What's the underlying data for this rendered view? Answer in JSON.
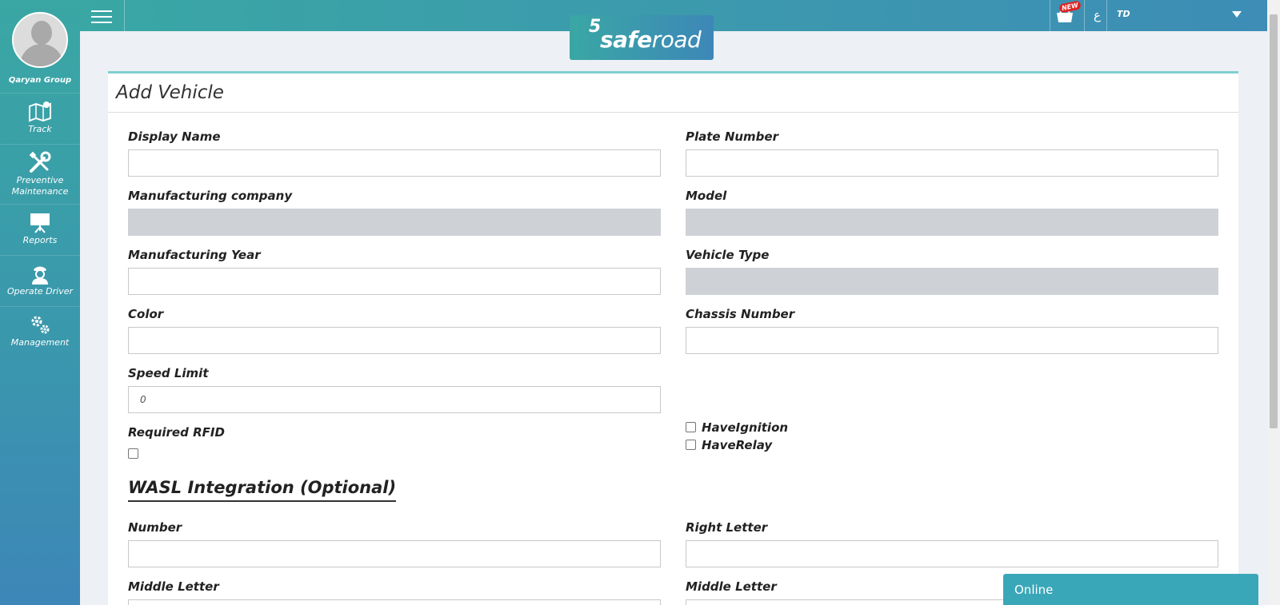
{
  "app": {
    "logo_mark": "5",
    "logo_text_bold": "safe",
    "logo_text_light": "road"
  },
  "sidebar": {
    "org_name": "Qaryan Group",
    "items": [
      {
        "label": "Track",
        "icon": "map-icon"
      },
      {
        "label": "Preventive Maintenance",
        "icon": "tools-icon"
      },
      {
        "label": "Reports",
        "icon": "presentation-board-icon"
      },
      {
        "label": "Operate Driver",
        "icon": "driver-icon"
      },
      {
        "label": "Management",
        "icon": "gears-icon"
      }
    ]
  },
  "topbar": {
    "new_badge": "NEW",
    "lang": "ع",
    "user": "TD"
  },
  "form": {
    "title": "Add Vehicle",
    "display_name": {
      "label": "Display Name",
      "value": ""
    },
    "plate_number": {
      "label": "Plate Number",
      "value": ""
    },
    "manufacturing_company": {
      "label": "Manufacturing company",
      "value": ""
    },
    "model": {
      "label": "Model",
      "value": ""
    },
    "manufacturing_year": {
      "label": "Manufacturing Year",
      "value": ""
    },
    "vehicle_type": {
      "label": "Vehicle Type",
      "value": ""
    },
    "color": {
      "label": "Color",
      "value": ""
    },
    "chassis_number": {
      "label": "Chassis Number",
      "value": ""
    },
    "speed_limit": {
      "label": "Speed Limit",
      "value": "0"
    },
    "required_rfid": {
      "label": "Required RFID",
      "checked": false
    },
    "have_ignition": {
      "label": "HaveIgnition",
      "checked": false
    },
    "have_relay": {
      "label": "HaveRelay",
      "checked": false
    },
    "wasl_section": "WASL Integration (Optional)",
    "number": {
      "label": "Number",
      "value": ""
    },
    "right_letter": {
      "label": "Right Letter",
      "value": ""
    },
    "middle_letter_left": {
      "label": "Middle Letter",
      "value": ""
    },
    "middle_letter_right": {
      "label": "Middle Letter",
      "value": ""
    }
  },
  "chat": {
    "status": "Online"
  },
  "colors": {
    "accent": "#3aa7a4",
    "accent_blue": "#3d86b8",
    "disabled_field": "#ced1d5"
  }
}
